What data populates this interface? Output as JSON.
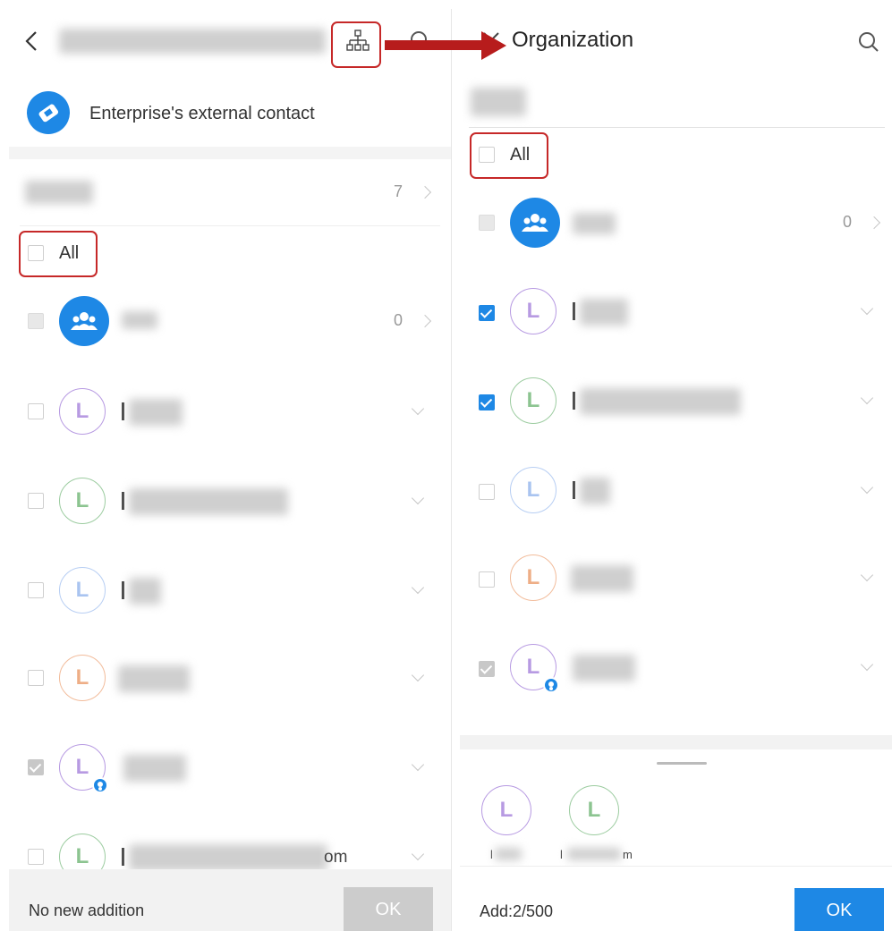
{
  "left": {
    "external_contact_label": "Enterprise's external contact",
    "department_count": "7",
    "all_label": "All",
    "group_count": "0",
    "avatar_letter": "L",
    "last_suffix": "om",
    "footer_status": "No new addition",
    "ok_label": "OK"
  },
  "right": {
    "title": "Organization",
    "all_label": "All",
    "group_count": "0",
    "avatar_letter": "L",
    "selected": [
      {
        "name_start": "l",
        "name_end": ""
      },
      {
        "name_start": "l",
        "name_end": "m"
      }
    ],
    "add_status": "Add:2/500",
    "ok_label": "OK"
  },
  "colors": {
    "accent": "#1e88e5",
    "annotation": "#c62828",
    "disabled_button": "#cccccc"
  },
  "icons": [
    "back-arrow-icon",
    "org-structure-icon",
    "search-icon",
    "handshake-icon",
    "group-icon",
    "close-icon",
    "arrow-right-icon",
    "chevron-down-icon",
    "chevron-right-icon",
    "user-badge-icon"
  ]
}
